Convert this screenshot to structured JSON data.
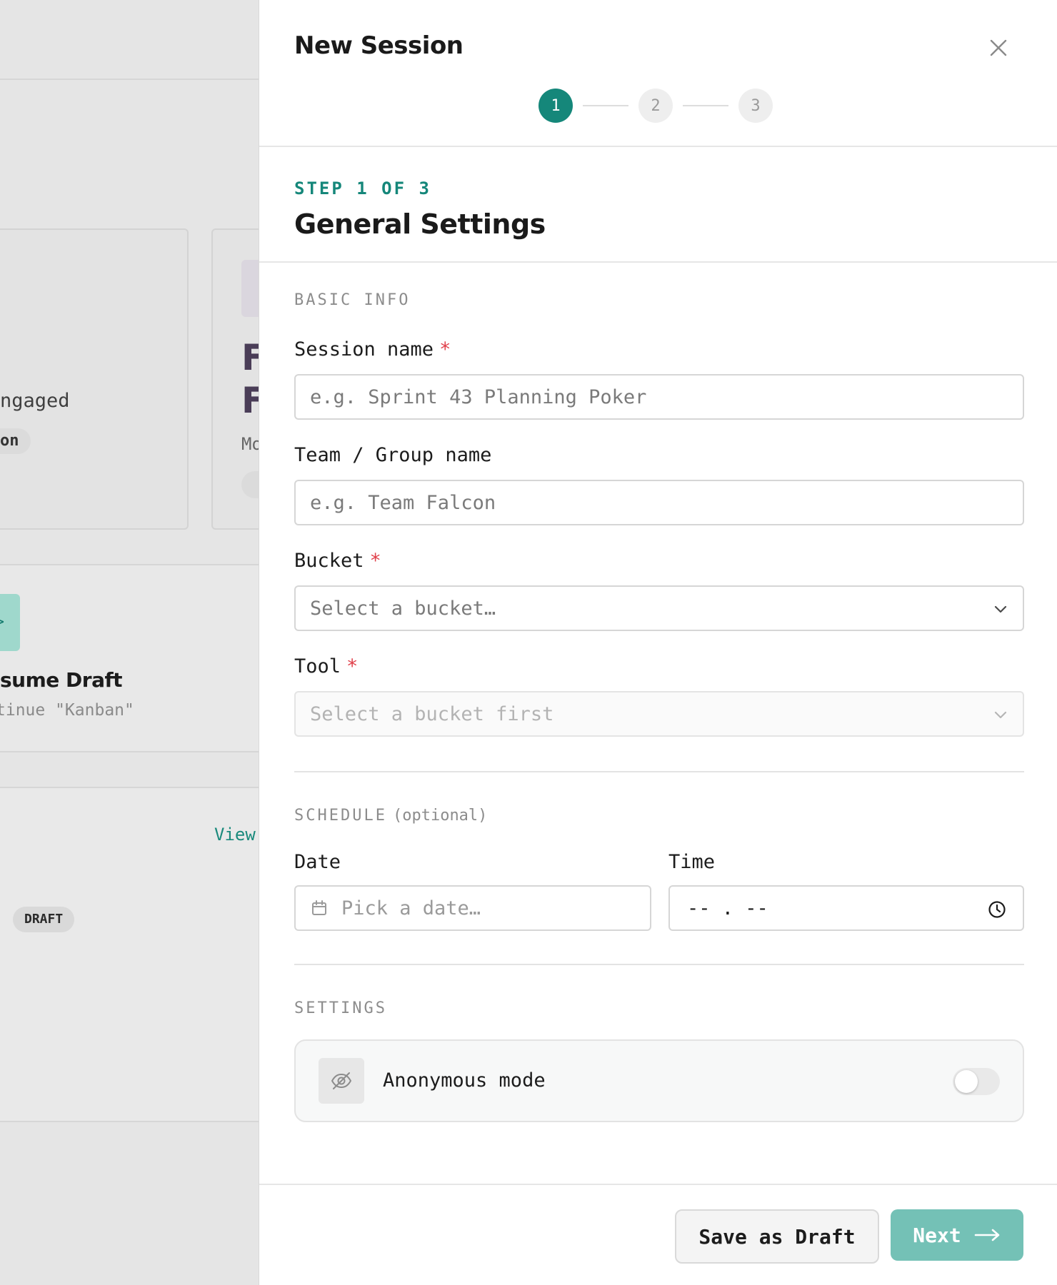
{
  "background": {
    "big_letters": [
      "F",
      "F"
    ],
    "engaged_text": "ngaged",
    "on_pill": "on",
    "card_meta": "Mo",
    "resume_title": "sume Draft",
    "resume_sub": "tinue \"Kanban\"",
    "teal_tile_glyph": ">",
    "view_link": "View",
    "draft_badge": "DRAFT"
  },
  "drawer": {
    "title": "New Session",
    "close_icon": "close-icon",
    "stepper": {
      "current": 1,
      "steps": [
        "1",
        "2",
        "3"
      ]
    },
    "step_label": "STEP 1 OF 3",
    "step_title": "General Settings"
  },
  "form": {
    "basic_info_label": "BASIC INFO",
    "session_name": {
      "label": "Session name",
      "required": "*",
      "placeholder": "e.g. Sprint 43 Planning Poker",
      "value": ""
    },
    "team_name": {
      "label": "Team / Group name",
      "placeholder": "e.g. Team Falcon",
      "value": ""
    },
    "bucket": {
      "label": "Bucket",
      "required": "*",
      "selected": "Select a bucket…"
    },
    "tool": {
      "label": "Tool",
      "required": "*",
      "selected": "Select a bucket first",
      "disabled": true
    },
    "schedule_label": "SCHEDULE",
    "schedule_optional": "(optional)",
    "date": {
      "label": "Date",
      "placeholder": "Pick a date…"
    },
    "time": {
      "label": "Time",
      "value": "-- . --"
    },
    "settings_label": "SETTINGS",
    "anonymous_mode": {
      "label": "Anonymous mode",
      "enabled": false,
      "icon": "eye-off-icon"
    }
  },
  "footer": {
    "save_draft_label": "Save as Draft",
    "next_label": "Next",
    "next_icon": "arrow-right-icon"
  },
  "colors": {
    "accent": "#15877a",
    "next_button": "#74c1b6",
    "required": "#e0414b"
  }
}
